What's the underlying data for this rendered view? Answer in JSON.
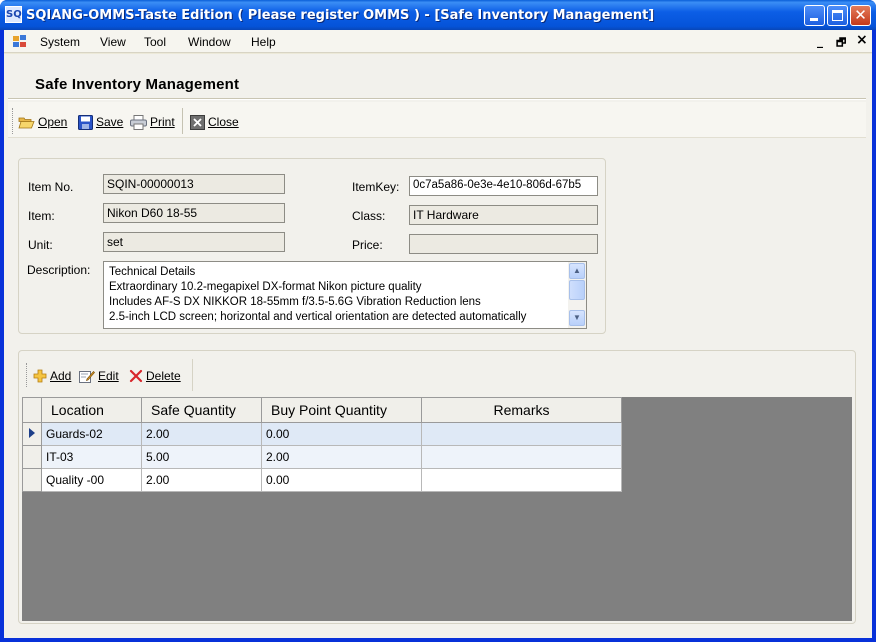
{
  "window": {
    "icon_text": "SQ",
    "title": "SQIANG-OMMS-Taste Edition ( Please register OMMS ) - [Safe Inventory Management]"
  },
  "menu": {
    "items": [
      "System",
      "View",
      "Tool",
      "Window",
      "Help"
    ],
    "mdi_min": "_",
    "mdi_restore": "🗗",
    "mdi_close": "×"
  },
  "form": {
    "title": "Safe Inventory Management"
  },
  "toolbar": {
    "open": "Open",
    "save": "Save",
    "print": "Print",
    "close": "Close"
  },
  "details": {
    "item_no_label": "Item No.",
    "item_no": "SQIN-00000013",
    "item_label": "Item:",
    "item": "Nikon D60 18-55",
    "unit_label": "Unit:",
    "unit": "set",
    "itemkey_label": "ItemKey:",
    "itemkey": "0c7a5a86-0e3e-4e10-806d-67b5",
    "class_label": "Class:",
    "class": "IT Hardware",
    "price_label": "Price:",
    "price": "",
    "description_label": "Description:",
    "description_lines": [
      "Technical Details",
      "Extraordinary 10.2-megapixel DX-format Nikon picture quality",
      "Includes AF-S DX NIKKOR 18-55mm f/3.5-5.6G Vibration Reduction lens",
      "2.5-inch LCD screen; horizontal and vertical orientation are detected automatically"
    ]
  },
  "grid_toolbar": {
    "add": "Add",
    "edit": "Edit",
    "delete": "Delete"
  },
  "grid": {
    "columns": [
      "Location",
      "Safe Quantity",
      "Buy Point Quantity",
      "Remarks"
    ],
    "rows": [
      [
        "Guards-02",
        "2.00",
        "0.00",
        ""
      ],
      [
        "IT-03",
        "5.00",
        "2.00",
        ""
      ],
      [
        "Quality -00",
        "2.00",
        "0.00",
        ""
      ]
    ],
    "selected_row": 0
  }
}
